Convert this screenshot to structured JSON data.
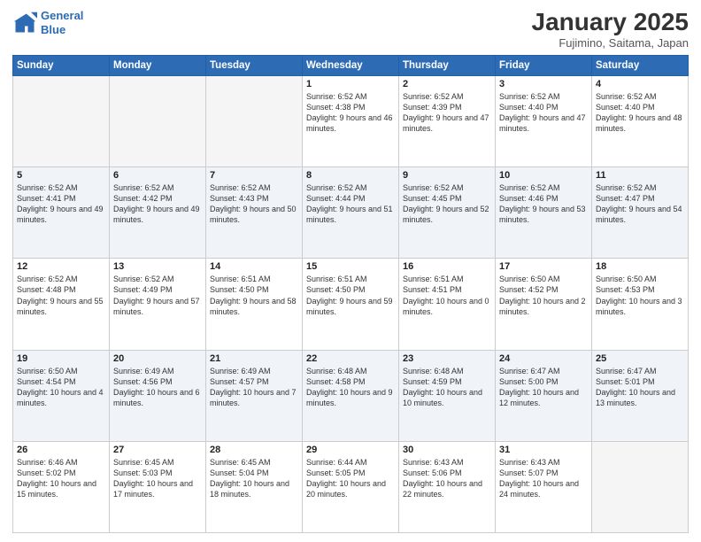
{
  "header": {
    "logo_line1": "General",
    "logo_line2": "Blue",
    "month": "January 2025",
    "location": "Fujimino, Saitama, Japan"
  },
  "weekdays": [
    "Sunday",
    "Monday",
    "Tuesday",
    "Wednesday",
    "Thursday",
    "Friday",
    "Saturday"
  ],
  "weeks": [
    [
      {
        "day": "",
        "text": ""
      },
      {
        "day": "",
        "text": ""
      },
      {
        "day": "",
        "text": ""
      },
      {
        "day": "1",
        "text": "Sunrise: 6:52 AM\nSunset: 4:38 PM\nDaylight: 9 hours and 46 minutes."
      },
      {
        "day": "2",
        "text": "Sunrise: 6:52 AM\nSunset: 4:39 PM\nDaylight: 9 hours and 47 minutes."
      },
      {
        "day": "3",
        "text": "Sunrise: 6:52 AM\nSunset: 4:40 PM\nDaylight: 9 hours and 47 minutes."
      },
      {
        "day": "4",
        "text": "Sunrise: 6:52 AM\nSunset: 4:40 PM\nDaylight: 9 hours and 48 minutes."
      }
    ],
    [
      {
        "day": "5",
        "text": "Sunrise: 6:52 AM\nSunset: 4:41 PM\nDaylight: 9 hours and 49 minutes."
      },
      {
        "day": "6",
        "text": "Sunrise: 6:52 AM\nSunset: 4:42 PM\nDaylight: 9 hours and 49 minutes."
      },
      {
        "day": "7",
        "text": "Sunrise: 6:52 AM\nSunset: 4:43 PM\nDaylight: 9 hours and 50 minutes."
      },
      {
        "day": "8",
        "text": "Sunrise: 6:52 AM\nSunset: 4:44 PM\nDaylight: 9 hours and 51 minutes."
      },
      {
        "day": "9",
        "text": "Sunrise: 6:52 AM\nSunset: 4:45 PM\nDaylight: 9 hours and 52 minutes."
      },
      {
        "day": "10",
        "text": "Sunrise: 6:52 AM\nSunset: 4:46 PM\nDaylight: 9 hours and 53 minutes."
      },
      {
        "day": "11",
        "text": "Sunrise: 6:52 AM\nSunset: 4:47 PM\nDaylight: 9 hours and 54 minutes."
      }
    ],
    [
      {
        "day": "12",
        "text": "Sunrise: 6:52 AM\nSunset: 4:48 PM\nDaylight: 9 hours and 55 minutes."
      },
      {
        "day": "13",
        "text": "Sunrise: 6:52 AM\nSunset: 4:49 PM\nDaylight: 9 hours and 57 minutes."
      },
      {
        "day": "14",
        "text": "Sunrise: 6:51 AM\nSunset: 4:50 PM\nDaylight: 9 hours and 58 minutes."
      },
      {
        "day": "15",
        "text": "Sunrise: 6:51 AM\nSunset: 4:50 PM\nDaylight: 9 hours and 59 minutes."
      },
      {
        "day": "16",
        "text": "Sunrise: 6:51 AM\nSunset: 4:51 PM\nDaylight: 10 hours and 0 minutes."
      },
      {
        "day": "17",
        "text": "Sunrise: 6:50 AM\nSunset: 4:52 PM\nDaylight: 10 hours and 2 minutes."
      },
      {
        "day": "18",
        "text": "Sunrise: 6:50 AM\nSunset: 4:53 PM\nDaylight: 10 hours and 3 minutes."
      }
    ],
    [
      {
        "day": "19",
        "text": "Sunrise: 6:50 AM\nSunset: 4:54 PM\nDaylight: 10 hours and 4 minutes."
      },
      {
        "day": "20",
        "text": "Sunrise: 6:49 AM\nSunset: 4:56 PM\nDaylight: 10 hours and 6 minutes."
      },
      {
        "day": "21",
        "text": "Sunrise: 6:49 AM\nSunset: 4:57 PM\nDaylight: 10 hours and 7 minutes."
      },
      {
        "day": "22",
        "text": "Sunrise: 6:48 AM\nSunset: 4:58 PM\nDaylight: 10 hours and 9 minutes."
      },
      {
        "day": "23",
        "text": "Sunrise: 6:48 AM\nSunset: 4:59 PM\nDaylight: 10 hours and 10 minutes."
      },
      {
        "day": "24",
        "text": "Sunrise: 6:47 AM\nSunset: 5:00 PM\nDaylight: 10 hours and 12 minutes."
      },
      {
        "day": "25",
        "text": "Sunrise: 6:47 AM\nSunset: 5:01 PM\nDaylight: 10 hours and 13 minutes."
      }
    ],
    [
      {
        "day": "26",
        "text": "Sunrise: 6:46 AM\nSunset: 5:02 PM\nDaylight: 10 hours and 15 minutes."
      },
      {
        "day": "27",
        "text": "Sunrise: 6:45 AM\nSunset: 5:03 PM\nDaylight: 10 hours and 17 minutes."
      },
      {
        "day": "28",
        "text": "Sunrise: 6:45 AM\nSunset: 5:04 PM\nDaylight: 10 hours and 18 minutes."
      },
      {
        "day": "29",
        "text": "Sunrise: 6:44 AM\nSunset: 5:05 PM\nDaylight: 10 hours and 20 minutes."
      },
      {
        "day": "30",
        "text": "Sunrise: 6:43 AM\nSunset: 5:06 PM\nDaylight: 10 hours and 22 minutes."
      },
      {
        "day": "31",
        "text": "Sunrise: 6:43 AM\nSunset: 5:07 PM\nDaylight: 10 hours and 24 minutes."
      },
      {
        "day": "",
        "text": ""
      }
    ]
  ]
}
